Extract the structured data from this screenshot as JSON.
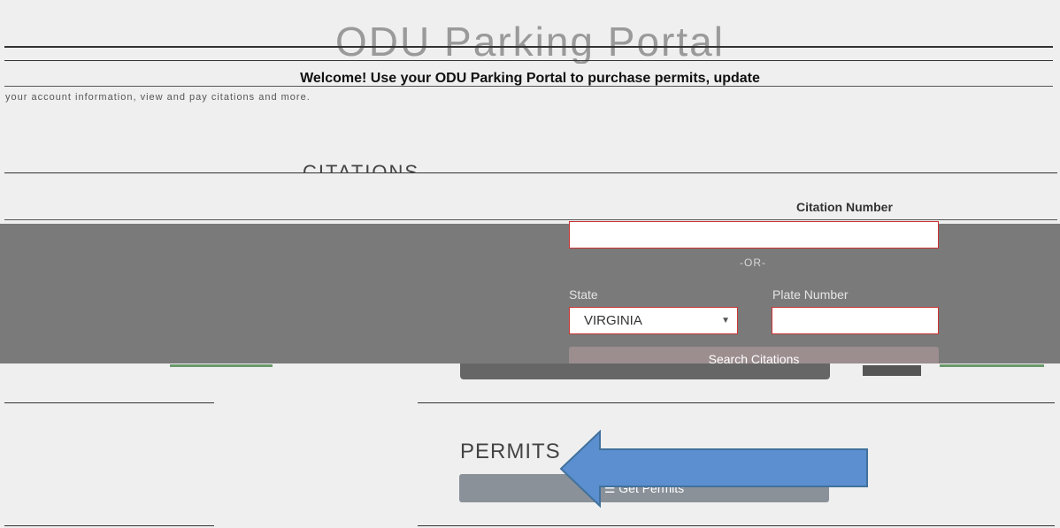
{
  "header": {
    "title": "ODU Parking Portal",
    "welcome": "Welcome! Use your ODU Parking Portal to purchase permits, update",
    "welcome_sub": "your account information, view and pay citations and more."
  },
  "citations": {
    "section_title": "CITATIONS",
    "citation_number_label": "Citation Number",
    "citation_number_value": "",
    "or_label": "-OR-",
    "state_label": "State",
    "state_value": "VIRGINIA",
    "plate_label": "Plate Number",
    "plate_value": "",
    "search_button": "Search Citations"
  },
  "permits": {
    "section_title": "PERMITS",
    "get_permits_button": "Get Permits"
  },
  "annotation": {
    "arrow_color": "#5b8fcf"
  }
}
